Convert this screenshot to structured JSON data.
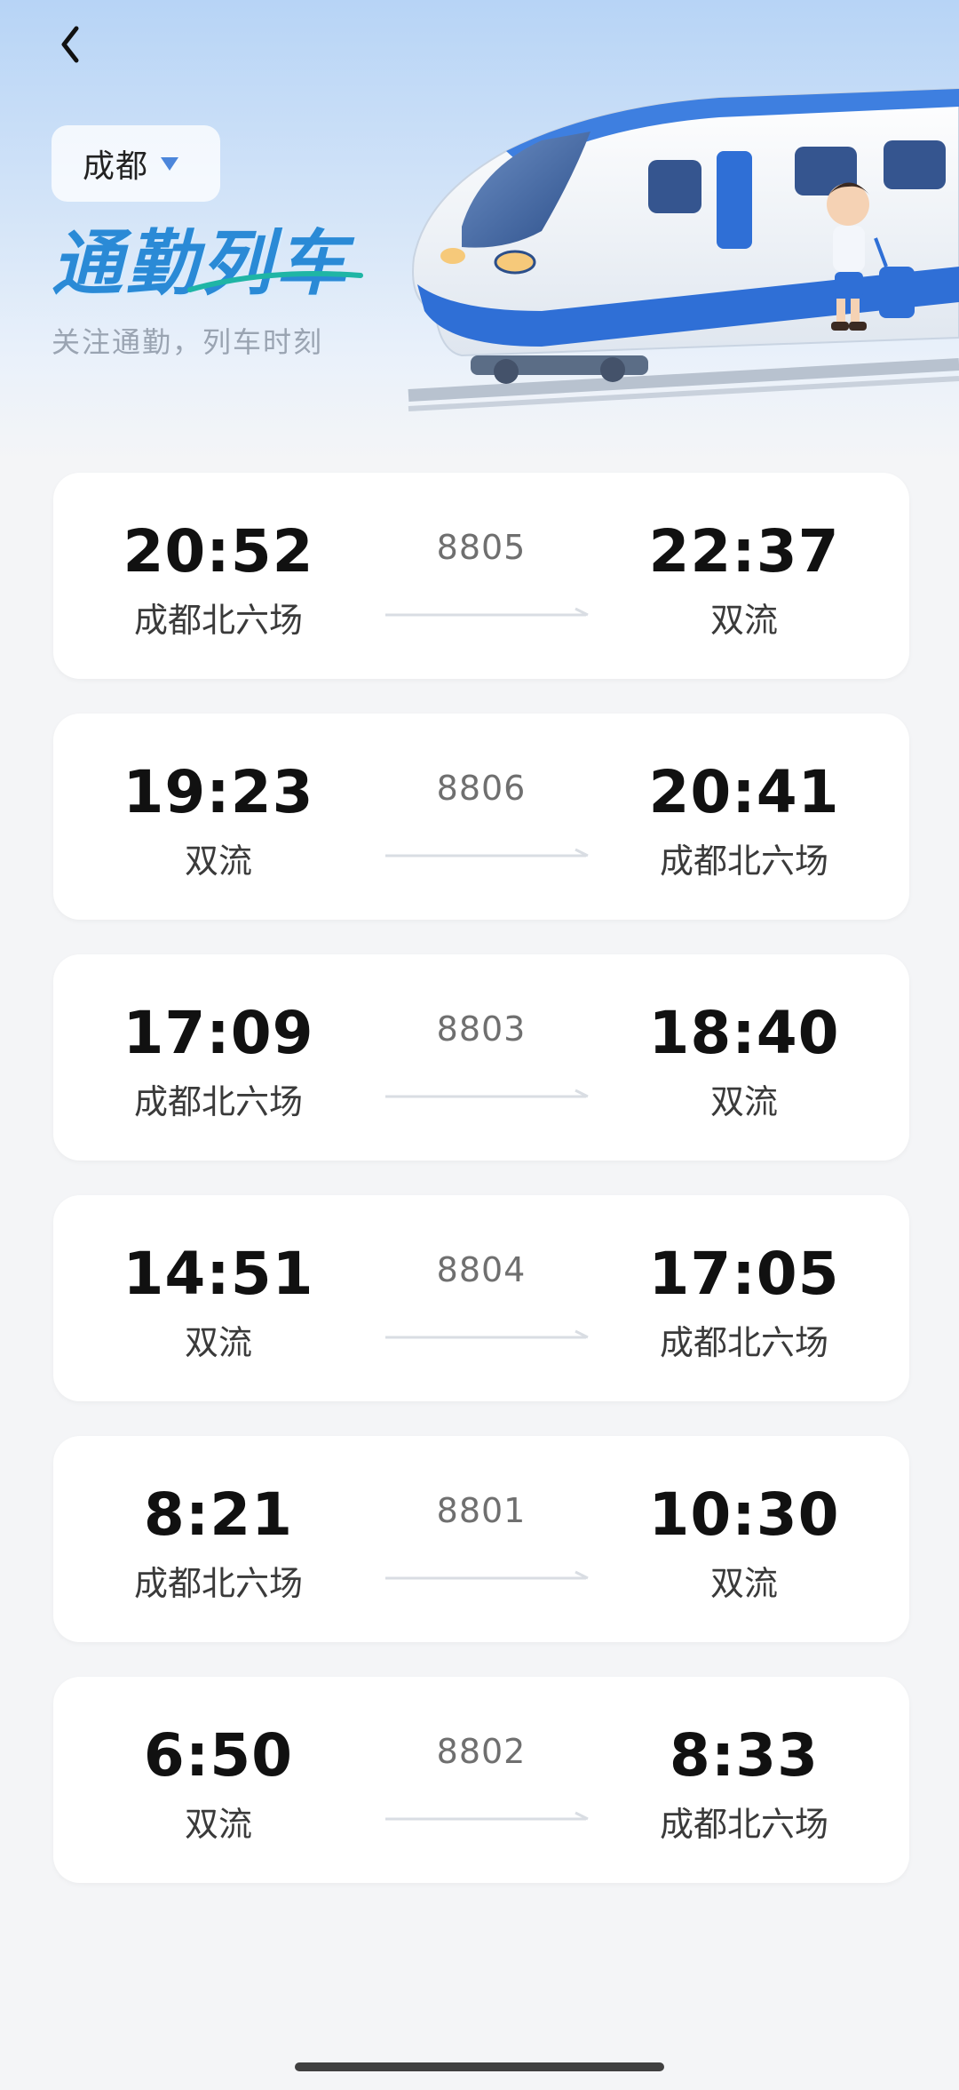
{
  "header": {
    "city": "成都",
    "title": "通勤列车",
    "subtitle": "关注通勤，列车时刻"
  },
  "colors": {
    "accent": "#2a8ad6",
    "dropdown_arrow": "#4c86db"
  },
  "trains": [
    {
      "depart_time": "20:52",
      "depart_station": "成都北六场",
      "train_no": "8805",
      "arrive_time": "22:37",
      "arrive_station": "双流"
    },
    {
      "depart_time": "19:23",
      "depart_station": "双流",
      "train_no": "8806",
      "arrive_time": "20:41",
      "arrive_station": "成都北六场"
    },
    {
      "depart_time": "17:09",
      "depart_station": "成都北六场",
      "train_no": "8803",
      "arrive_time": "18:40",
      "arrive_station": "双流"
    },
    {
      "depart_time": "14:51",
      "depart_station": "双流",
      "train_no": "8804",
      "arrive_time": "17:05",
      "arrive_station": "成都北六场"
    },
    {
      "depart_time": "8:21",
      "depart_station": "成都北六场",
      "train_no": "8801",
      "arrive_time": "10:30",
      "arrive_station": "双流"
    },
    {
      "depart_time": "6:50",
      "depart_station": "双流",
      "train_no": "8802",
      "arrive_time": "8:33",
      "arrive_station": "成都北六场"
    }
  ]
}
